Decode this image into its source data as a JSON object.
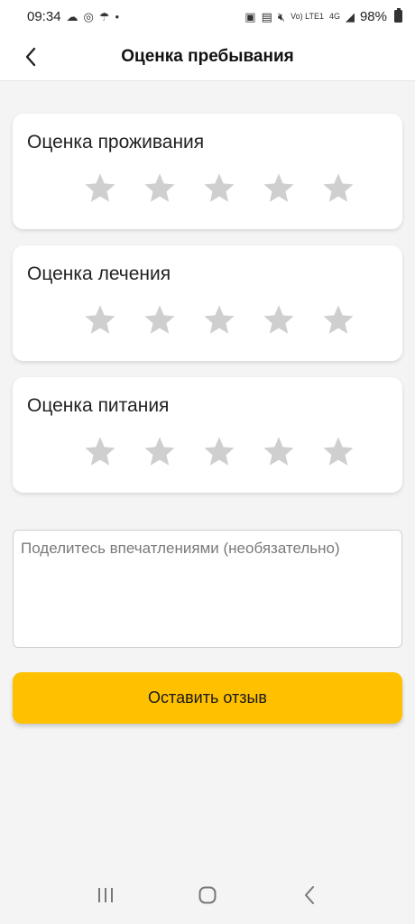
{
  "status_bar": {
    "time": "09:34",
    "battery": "98%",
    "network": "4G",
    "volte": "Vo) LTE1"
  },
  "header": {
    "title": "Оценка пребывания"
  },
  "ratings": [
    {
      "title": "Оценка проживания",
      "stars_total": 5,
      "stars_selected": 0
    },
    {
      "title": "Оценка лечения",
      "stars_total": 5,
      "stars_selected": 0
    },
    {
      "title": "Оценка питания",
      "stars_total": 5,
      "stars_selected": 0
    }
  ],
  "comment": {
    "placeholder": "Поделитесь впечатлениями (необязательно)",
    "value": ""
  },
  "submit": {
    "label": "Оставить отзыв"
  },
  "colors": {
    "accent": "#ffc000",
    "star_inactive": "#cfcfcf",
    "background": "#f4f4f4"
  },
  "icons": {
    "back": "chevron-left-icon",
    "star": "star-icon",
    "nav_recent": "recent-apps-icon",
    "nav_home": "home-icon",
    "nav_back": "nav-back-icon"
  }
}
